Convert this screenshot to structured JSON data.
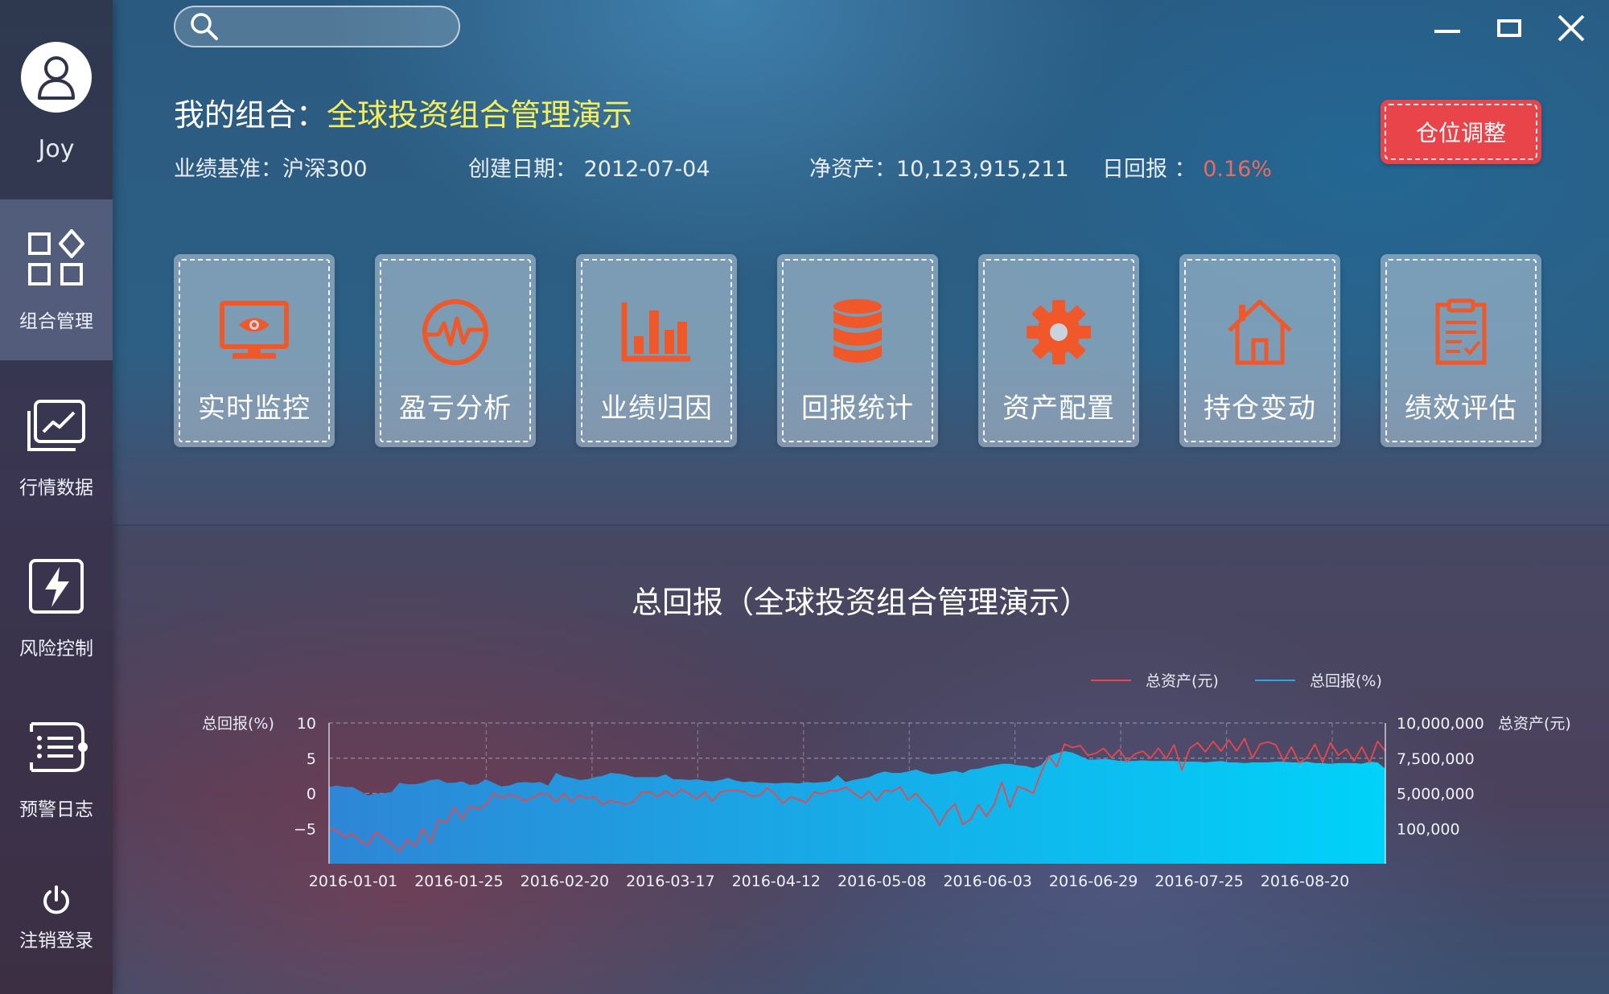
{
  "user": {
    "name": "Joy"
  },
  "sidebar": {
    "items": [
      {
        "label": "组合管理",
        "icon": "grid-icon"
      },
      {
        "label": "行情数据",
        "icon": "market-chart-icon"
      },
      {
        "label": "风险控制",
        "icon": "lightning-icon"
      },
      {
        "label": "预警日志",
        "icon": "list-icon"
      }
    ],
    "logout": {
      "label": "注销登录",
      "icon": "power-icon"
    }
  },
  "search": {
    "placeholder": ""
  },
  "portfolio": {
    "title_label": "我的组合：",
    "title_value": "全球投资组合管理演示",
    "benchmark": "业绩基准：沪深300",
    "created": "创建日期：  2012-07-04",
    "net_assets": "净资产：10,123,915,211",
    "daily_return_label": "日回报 ：",
    "daily_return_value": "0.16%"
  },
  "adjust_button": {
    "label": "仓位调整"
  },
  "modules": [
    {
      "label": "实时监控",
      "icon": "monitor-eye-icon"
    },
    {
      "label": "盈亏分析",
      "icon": "pulse-icon"
    },
    {
      "label": "业绩归因",
      "icon": "bar-chart-icon"
    },
    {
      "label": "回报统计",
      "icon": "database-icon"
    },
    {
      "label": "资产配置",
      "icon": "gear-icon"
    },
    {
      "label": "持仓变动",
      "icon": "house-icon"
    },
    {
      "label": "绩效评估",
      "icon": "clipboard-check-icon"
    }
  ],
  "colors": {
    "accent_orange": "#f0582a",
    "title_yellow": "#f6ef5a",
    "return_red": "#ec6a5e",
    "button_red": "#e8444a",
    "series_assets": "#e8474c",
    "series_return": "#2ea4ea"
  },
  "chart_data": {
    "type": "area",
    "title": "总回报（全球投资组合管理演示）",
    "x_ticks": [
      "2016-01-01",
      "2016-01-25",
      "2016-02-20",
      "2016-03-17",
      "2016-04-12",
      "2016-05-08",
      "2016-06-03",
      "2016-06-29",
      "2016-07-25",
      "2016-08-20"
    ],
    "y_left": {
      "label": "总回报(%)",
      "ticks": [
        "10",
        "5",
        "0",
        "−5"
      ],
      "range": [
        -10,
        10
      ]
    },
    "y_right": {
      "label": "总资产(元)",
      "ticks": [
        "10,000,000",
        "7,500,000",
        "5,000,000",
        "100,000"
      ]
    },
    "grid": true,
    "legend_position": "top-right",
    "series": [
      {
        "name": "总资产(元)",
        "axis": "right",
        "color": "#e8474c",
        "values": [
          -5.0,
          -5.3,
          -6.2,
          -5.7,
          -6.8,
          -7.3,
          -5.5,
          -6.4,
          -7.2,
          -8.3,
          -6.6,
          -7.5,
          -5.0,
          -7.0,
          -3.7,
          -4.2,
          -2.0,
          -3.7,
          -1.8,
          -2.2,
          -1.7,
          0.0,
          -0.6,
          -0.2,
          -0.4,
          -1.1,
          -0.6,
          0.0,
          -0.1,
          -1.2,
          0.0,
          -1.2,
          -0.2,
          -0.7,
          -0.5,
          -1.6,
          -1.0,
          -1.3,
          -1.6,
          -1.1,
          0.2,
          0.2,
          -0.5,
          0.4,
          -0.4,
          0.6,
          0.0,
          -0.8,
          0.2,
          -1.1,
          0.2,
          0.4,
          0.4,
          0.3,
          -0.4,
          -0.3,
          0.8,
          -0.1,
          -1.4,
          -0.5,
          -0.9,
          -1.3,
          0.2,
          -0.1,
          0.4,
          0.4,
          0.9,
          0.1,
          -0.7,
          0.3,
          -1.0,
          0.4,
          0.3,
          0.9,
          -0.9,
          0.0,
          -1.3,
          -2.4,
          -4.5,
          -2.6,
          -1.5,
          -4.4,
          -3.7,
          -1.6,
          -3.3,
          -1.6,
          1.6,
          -2.0,
          1.0,
          0.6,
          0.0,
          3.0,
          5.3,
          3.8,
          7.0,
          6.5,
          6.8,
          5.4,
          5.7,
          6.4,
          5.1,
          6.2,
          4.5,
          5.6,
          6.0,
          5.0,
          6.4,
          4.9,
          6.9,
          3.3,
          6.4,
          7.2,
          5.9,
          7.4,
          6.0,
          7.6,
          6.0,
          7.8,
          5.0,
          7.0,
          7.3,
          6.9,
          4.6,
          6.6,
          4.3,
          5.1,
          7.0,
          4.4,
          7.2,
          5.4,
          6.3,
          4.6,
          6.6,
          4.4,
          7.4,
          6.0
        ]
      },
      {
        "name": "总回报(%)",
        "axis": "left",
        "color": "#2ea4ea",
        "values": [
          0.9,
          1.1,
          0.9,
          0.9,
          0.3,
          -0.3,
          0.0,
          0.0,
          0.2,
          1.5,
          1.3,
          1.3,
          1.5,
          1.9,
          2.0,
          1.5,
          1.5,
          1.7,
          1.2,
          1.3,
          2.0,
          1.5,
          1.0,
          1.1,
          1.5,
          1.6,
          1.5,
          1.6,
          1.1,
          2.9,
          2.4,
          2.2,
          1.9,
          2.0,
          2.3,
          2.5,
          2.9,
          2.8,
          2.6,
          2.3,
          2.3,
          2.3,
          2.3,
          2.7,
          2.0,
          2.0,
          1.9,
          2.0,
          1.8,
          1.7,
          1.9,
          2.2,
          1.8,
          1.6,
          1.7,
          1.5,
          1.5,
          1.4,
          1.5,
          1.5,
          1.4,
          1.6,
          1.5,
          1.6,
          1.7,
          2.6,
          1.6,
          1.9,
          2.1,
          2.3,
          2.8,
          3.1,
          2.9,
          2.9,
          3.1,
          3.4,
          3.0,
          2.7,
          2.8,
          3.0,
          3.2,
          2.9,
          3.4,
          3.5,
          3.8,
          4.0,
          4.2,
          4.2,
          4.0,
          3.9,
          3.6,
          4.0,
          5.3,
          5.7,
          6.0,
          5.8,
          5.3,
          4.8,
          4.8,
          4.9,
          4.8,
          4.6,
          4.6,
          4.6,
          4.7,
          4.6,
          4.6,
          4.6,
          4.6,
          4.5,
          4.5,
          4.5,
          4.4,
          4.5,
          4.6,
          4.4,
          4.4,
          4.3,
          4.4,
          4.4,
          4.4,
          4.5,
          4.5,
          4.4,
          4.4,
          4.5,
          4.3,
          4.3,
          4.2,
          4.3,
          4.3,
          4.3,
          4.2,
          4.5,
          4.4,
          3.5
        ]
      }
    ]
  }
}
